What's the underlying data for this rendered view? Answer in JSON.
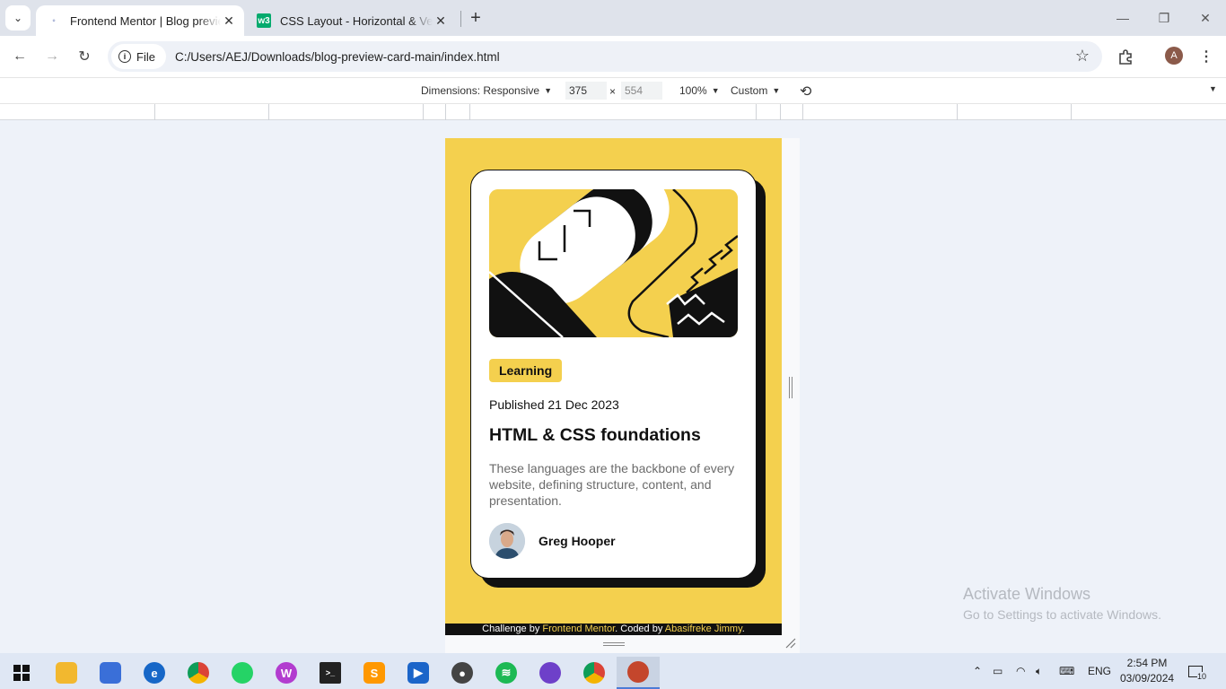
{
  "browser": {
    "tabs": [
      {
        "title": "Frontend Mentor | Blog preview card",
        "active": true
      },
      {
        "title": "CSS Layout - Horizontal & Vertical Align",
        "active": false
      }
    ],
    "file_chip": "File",
    "url": "C:/Users/AEJ/Downloads/blog-preview-card-main/index.html",
    "profile_initial": "A"
  },
  "devtools": {
    "dimensions_label": "Dimensions: Responsive",
    "width": "375",
    "times": "×",
    "height": "554",
    "zoom": "100%",
    "throttle": "Custom"
  },
  "card": {
    "badge": "Learning",
    "published": "Published 21 Dec 2023",
    "title": "HTML & CSS foundations",
    "excerpt": "These languages are the backbone of every website, defining structure, content, and presentation.",
    "author": "Greg Hooper"
  },
  "attribution": {
    "prefix": "Challenge by ",
    "fm": "Frontend Mentor",
    "mid": ". Coded by ",
    "coder": "Abasifreke Jimmy",
    "end": "."
  },
  "watermark": {
    "line1": "Activate Windows",
    "line2": "Go to Settings to activate Windows."
  },
  "system_tray": {
    "lang": "ENG",
    "time": "2:54 PM",
    "date": "03/09/2024",
    "notifications": "10"
  },
  "colors": {
    "yellow": "#f4d04e",
    "black": "#111111",
    "grey_text": "#6b6b6b"
  }
}
